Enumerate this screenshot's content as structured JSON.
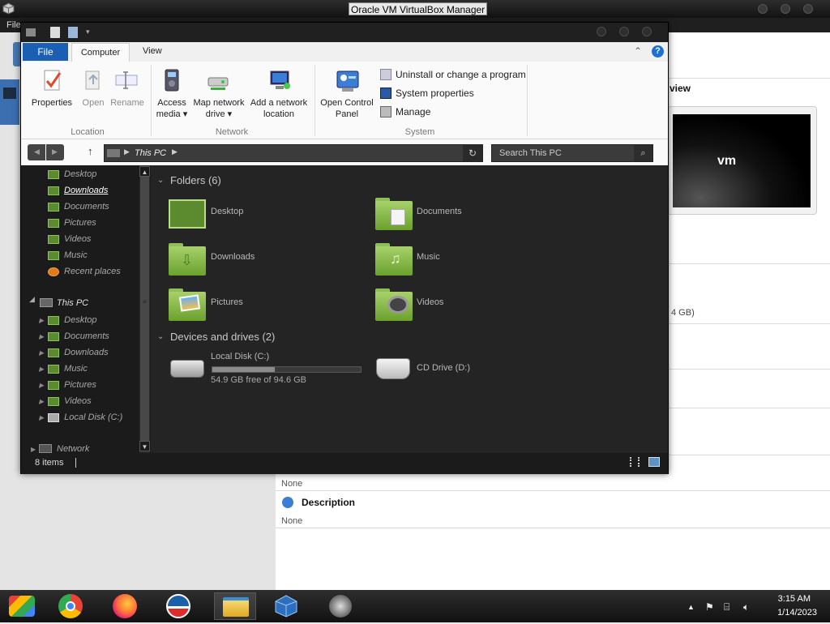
{
  "vbox": {
    "title": "Oracle VM VirtualBox Manager",
    "menu_file": "File",
    "preview_heading": "view",
    "preview_vm_name": "vm",
    "disk_size_fragment": "4 GB)",
    "usb_value": "None",
    "description_heading": "Description",
    "description_value": "None"
  },
  "explorer": {
    "tabs": {
      "file": "File",
      "computer": "Computer",
      "view": "View"
    },
    "ribbon": {
      "location": {
        "label": "Location",
        "properties": "Properties",
        "open": "Open",
        "rename": "Rename"
      },
      "network": {
        "label": "Network",
        "access_media_1": "Access",
        "access_media_2": "media ▾",
        "map_drive_1": "Map network",
        "map_drive_2": "drive ▾",
        "add_location_1": "Add a network",
        "add_location_2": "location"
      },
      "system": {
        "label": "System",
        "control_panel_1": "Open Control",
        "control_panel_2": "Panel",
        "uninstall": "Uninstall or change a program",
        "system_properties": "System properties",
        "manage": "Manage"
      }
    },
    "address": {
      "path": "This PC",
      "search_placeholder": "Search This PC"
    },
    "nav_pane": {
      "quick": [
        "Desktop",
        "Downloads",
        "Documents",
        "Pictures",
        "Videos",
        "Music",
        "Recent places"
      ],
      "this_pc": "This PC",
      "this_pc_items": [
        "Desktop",
        "Documents",
        "Downloads",
        "Music",
        "Pictures",
        "Videos",
        "Local Disk (C:)"
      ],
      "network": "Network"
    },
    "folders_header": "Folders (6)",
    "folders": [
      "Desktop",
      "Documents",
      "Downloads",
      "Music",
      "Pictures",
      "Videos"
    ],
    "drives_header": "Devices and drives (2)",
    "drives": {
      "c_name": "Local Disk (C:)",
      "c_free": "54.9 GB free of 94.6 GB",
      "c_used_fraction": 0.42,
      "d_name": "CD Drive (D:)"
    },
    "status": "8 items"
  },
  "taskbar": {
    "time": "3:15 AM",
    "date": "1/14/2023",
    "apps": [
      "chrome-remote-desktop",
      "chrome",
      "firefox",
      "obama-logo",
      "file-explorer",
      "virtualbox",
      "speaker"
    ]
  },
  "colors": {
    "accent": "#1a5fb4",
    "folder_green": "#8cc35a"
  }
}
